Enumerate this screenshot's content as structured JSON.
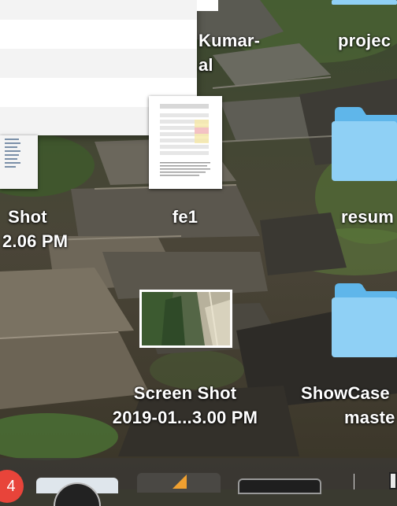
{
  "desktop": {
    "items": [
      {
        "id": "screenshot-left",
        "line1": "Shot",
        "line2": "2.06 PM"
      },
      {
        "id": "kumar-file",
        "line1": "Kumar-",
        "line2": "al"
      },
      {
        "id": "fe1",
        "line1": "fe1",
        "line2": ""
      },
      {
        "id": "screenshot-selected",
        "line1": "Screen Shot",
        "line2": "2019-01...3.00 PM"
      },
      {
        "id": "folder-projects",
        "line1": "projec",
        "line2": ""
      },
      {
        "id": "folder-resume",
        "line1": "resum",
        "line2": ""
      },
      {
        "id": "folder-showcase",
        "line1": "ShowCase",
        "line2": "maste"
      }
    ]
  },
  "dock": {
    "badge_count": "4"
  },
  "colors": {
    "folder_light": "#8fd0f5",
    "folder_dark": "#5fb6ea",
    "selection_border": "#ffffff",
    "dock_badge": "#e8443a"
  }
}
